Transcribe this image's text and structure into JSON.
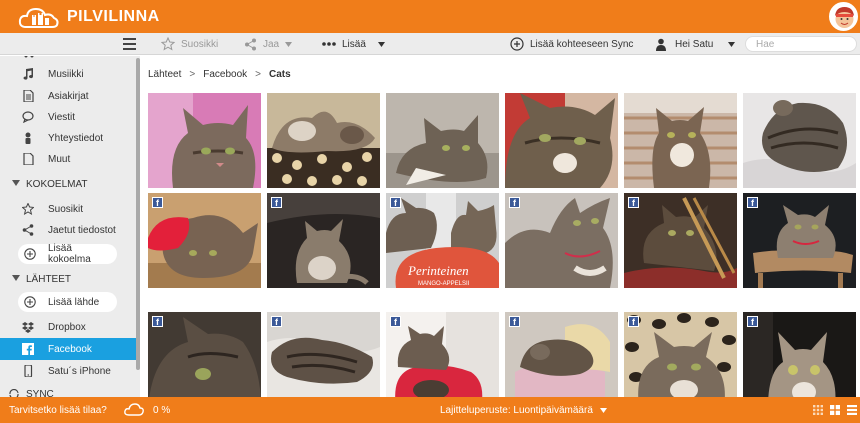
{
  "app": {
    "title": "PILVILINNA",
    "brand_color": "#f07d1a",
    "accent_color": "#1aa0e0"
  },
  "toolbar": {
    "favorites_label": "Suosikki",
    "share_label": "Jaa",
    "more_label": "Lisää",
    "add_to_sync_label": "Lisää kohteeseen Sync",
    "user_label": "Hei Satu",
    "search_placeholder": "Hae"
  },
  "sidebar": {
    "items_top": [
      {
        "label": "Musiikki",
        "icon": "music-note-icon"
      },
      {
        "label": "Asiakirjat",
        "icon": "document-icon"
      },
      {
        "label": "Viestit",
        "icon": "chat-bubble-icon"
      },
      {
        "label": "Yhteystiedot",
        "icon": "person-icon"
      },
      {
        "label": "Muut",
        "icon": "file-icon"
      }
    ],
    "collections": {
      "title": "KOKOELMAT",
      "items": [
        {
          "label": "Suosikit",
          "icon": "star-icon"
        },
        {
          "label": "Jaetut tiedostot",
          "icon": "share-icon"
        }
      ],
      "add_label": "Lisää kokoelma"
    },
    "sources": {
      "title": "LÄHTEET",
      "add_label": "Lisää lähde",
      "items": [
        {
          "label": "Dropbox",
          "icon": "dropbox-icon"
        },
        {
          "label": "Facebook",
          "icon": "facebook-icon",
          "active": true
        },
        {
          "label": "Satu´s iPhone",
          "icon": "phone-icon"
        }
      ]
    },
    "sync_title": "SYNC"
  },
  "breadcrumb": {
    "items": [
      "Lähteet",
      "Facebook",
      "Cats"
    ],
    "separator": ">"
  },
  "photos": {
    "rows": 3,
    "cols": 6,
    "fb_badge_letter": "f",
    "items": [
      {
        "subject": "kitten-pink-background",
        "fb": false
      },
      {
        "subject": "cats-on-leopard-blanket",
        "fb": false
      },
      {
        "subject": "tabby-on-grey-floor",
        "fb": false
      },
      {
        "subject": "tabby-closeup",
        "fb": false
      },
      {
        "subject": "tabby-sitting-striped",
        "fb": false
      },
      {
        "subject": "cat-on-white-sheet",
        "fb": false
      },
      {
        "subject": "cat-with-red-hat",
        "fb": true
      },
      {
        "subject": "kitten-on-dark-fur",
        "fb": true
      },
      {
        "subject": "cats-with-perinteinen-box",
        "fb": true,
        "caption": "Perinteinen",
        "caption2": "MANGO-APPELSII"
      },
      {
        "subject": "tabby-looking-up",
        "fb": true
      },
      {
        "subject": "cat-in-basket",
        "fb": true
      },
      {
        "subject": "cat-on-chair-back",
        "fb": true
      },
      {
        "subject": "dark-tabby-closeup",
        "fb": true
      },
      {
        "subject": "cat-lying-on-bed",
        "fb": true
      },
      {
        "subject": "kitten-on-red-pillow",
        "fb": true
      },
      {
        "subject": "cat-sleeping-basket",
        "fb": true
      },
      {
        "subject": "cat-on-leopard-print",
        "fb": true
      },
      {
        "subject": "cat-looking-up-dark",
        "fb": true
      }
    ]
  },
  "footer": {
    "storage_prompt": "Tarvitsetko lisää tilaa?",
    "storage_percent": "0 %",
    "sort_label": "Lajitteluperuste: Luontipäivämäärä"
  }
}
